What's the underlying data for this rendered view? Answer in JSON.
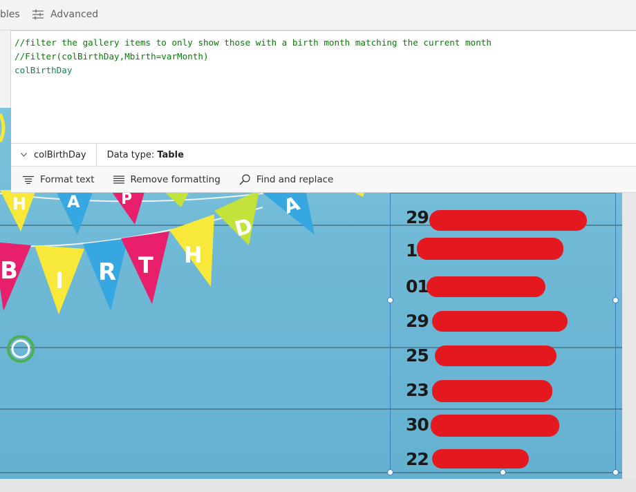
{
  "topbar": {
    "tables_label": "bles",
    "advanced_label": "Advanced"
  },
  "editor": {
    "lines": [
      "//filter the gallery items to only show those with a birth month matching the current month",
      "//Filter(colBirthDay,Mbirth=varMonth)",
      "colBirthDay"
    ]
  },
  "status": {
    "name": "colBirthDay",
    "data_type_prefix": "Data type: ",
    "data_type_value": "Table"
  },
  "toolbar": {
    "format_text": "Format text",
    "remove_formatting": "Remove formatting",
    "find_replace": "Find and replace"
  },
  "banner": {
    "row1_letters": [
      "H",
      "A",
      "P",
      "P",
      "D",
      "A"
    ],
    "row2_letters": [
      "B",
      "I",
      "R",
      "T",
      "H"
    ]
  },
  "gallery": {
    "days": [
      "29",
      "13",
      "01",
      "29",
      "25",
      "23",
      "30",
      "22"
    ]
  },
  "colors": {
    "code_comment": "#008000",
    "code_identifier": "#098658",
    "selection": "#3f7cc4",
    "redaction": "#e3191f"
  }
}
